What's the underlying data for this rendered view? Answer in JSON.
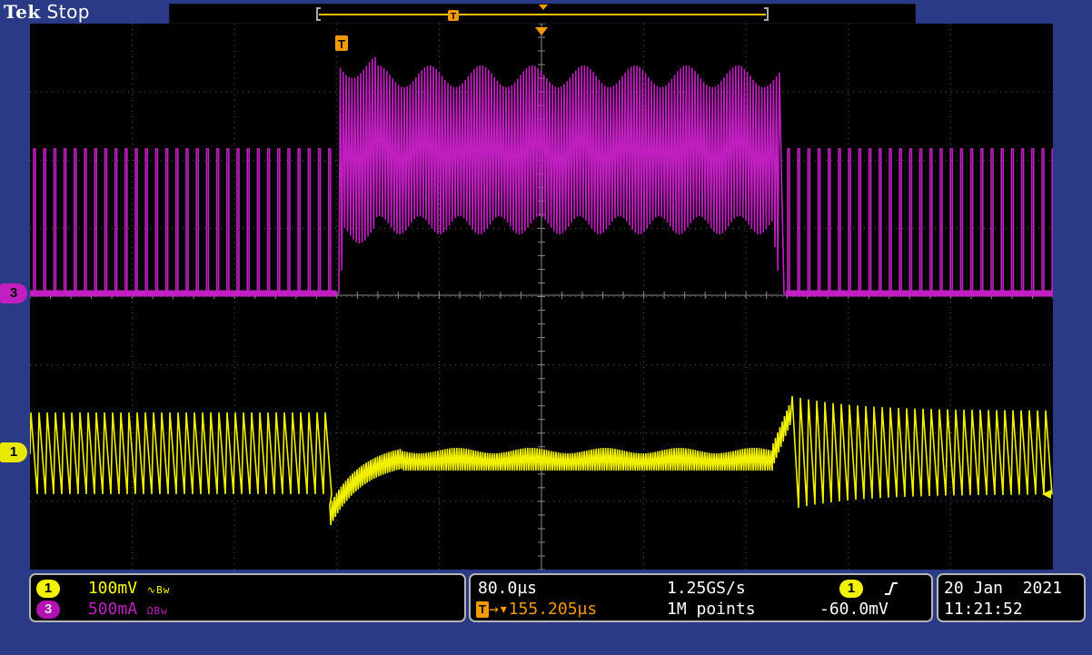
{
  "header": {
    "brand": "Tek",
    "status": "Stop"
  },
  "markers": {
    "ch3": "3",
    "ch1": "1",
    "trigger": "T"
  },
  "colors": {
    "background": "#2b3a86",
    "ch1": "#ffff00",
    "ch3": "#c21fc2",
    "trigger": "#f39a00",
    "graticule": "#6f6f6f"
  },
  "channels": [
    {
      "id": "1",
      "scale": "100mV",
      "coupling_symbols": "∿Bw"
    },
    {
      "id": "3",
      "scale": "500mA",
      "coupling_symbols": "ΩBw"
    }
  ],
  "horizontal": {
    "time_per_div": "80.0µs",
    "sample_rate": "1.25GS/s",
    "trigger_position": "155.205µs",
    "record_length": "1M points"
  },
  "trigger": {
    "source": "1",
    "slope_symbol": "⌠",
    "level": "-60.0mV"
  },
  "datetime": {
    "date": "20 Jan  2021",
    "time": "11:21:52"
  }
}
